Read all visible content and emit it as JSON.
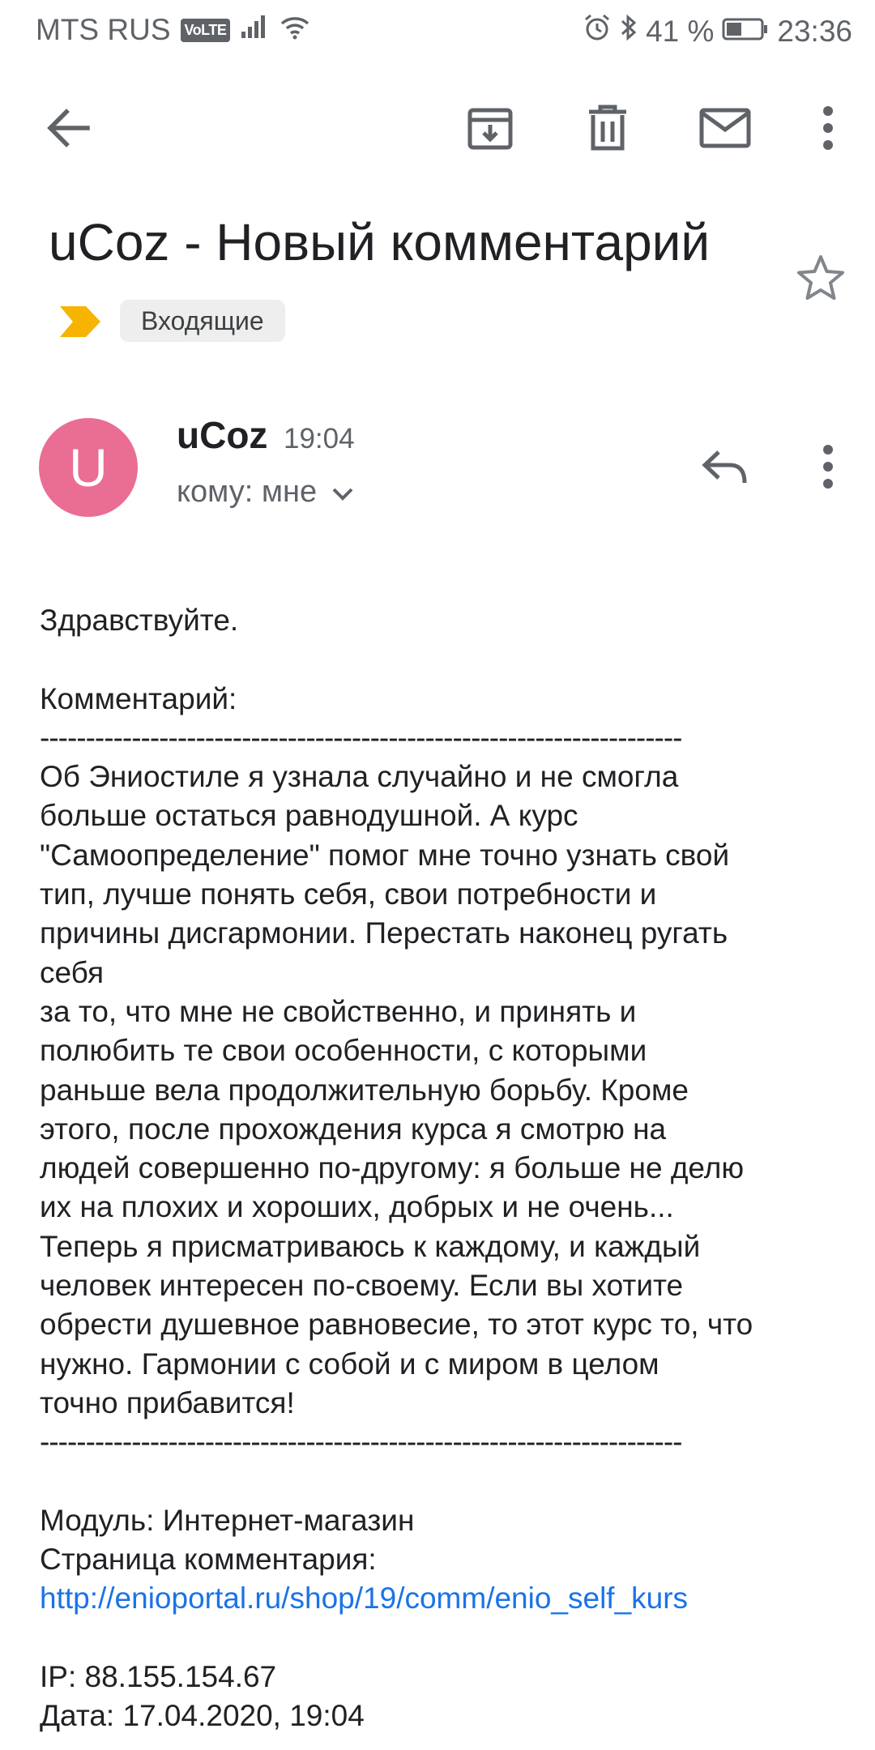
{
  "status_bar": {
    "carrier": "MTS RUS",
    "volte": "VoLTE",
    "battery": "41 %",
    "time": "23:36"
  },
  "email": {
    "subject": "uCoz - Новый комментарий",
    "label": "Входящие",
    "sender_initial": "U",
    "sender": "uCoz",
    "time": "19:04",
    "recipient": "кому: мне",
    "body_lines": [
      "Здравствуйте.",
      "",
      "Комментарий:",
      "----------------------------------------------------------------------",
      "Об Эниостиле я узнала случайно и не смогла",
      "больше остаться равнодушной. А курс",
      "\"Самоопределение\" помог мне точно узнать свой",
      "тип, лучше понять себя, свои потребности и",
      "причины дисгармонии. Перестать наконец ругать",
      "себя",
      "за то, что мне не свойственно, и принять и",
      "полюбить те свои особенности, с которыми",
      "раньше вела продолжительную борьбу. Кроме",
      "этого, после прохождения курса я смотрю на",
      "людей совершенно по-другому: я больше не делю",
      "их на плохих и хороших, добрых и не очень...",
      "Теперь я присматриваюсь к каждому, и каждый",
      "человек интересен по-своему. Если вы хотите",
      "обрести душевное равновесие, то этот курс то, что",
      "нужно. Гармонии с собой и с миром в целом",
      "точно прибавится!",
      "----------------------------------------------------------------------",
      "",
      "Модуль: Интернет-магазин",
      "Страница комментария:"
    ],
    "link": "http://enioportal.ru/shop/19/comm/enio_self_kurs",
    "ip_line": "IP: 88.155.154.67",
    "date_line": "Дата: 17.04.2020, 19:04"
  },
  "icons": {
    "back": "arrow-back-icon",
    "archive": "archive-icon",
    "delete": "trash-icon",
    "mark_unread": "mail-icon",
    "more": "more-vert-icon",
    "star": "star-outline-icon",
    "label_marker": "important-marker-icon",
    "reply": "reply-icon",
    "expand": "chevron-down-icon"
  },
  "colors": {
    "avatar": "#ea6d94",
    "link": "#1a73e8",
    "important_marker": "#f6b400"
  }
}
